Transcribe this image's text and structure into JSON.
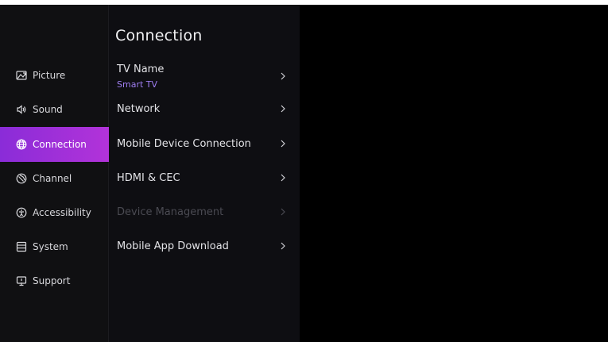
{
  "sidebar": {
    "items": [
      {
        "id": "picture",
        "label": "Picture",
        "icon": "picture-icon",
        "active": false
      },
      {
        "id": "sound",
        "label": "Sound",
        "icon": "speaker-icon",
        "active": false
      },
      {
        "id": "connection",
        "label": "Connection",
        "icon": "globe-icon",
        "active": true
      },
      {
        "id": "channel",
        "label": "Channel",
        "icon": "satellite-dish-icon",
        "active": false
      },
      {
        "id": "accessibility",
        "label": "Accessibility",
        "icon": "accessibility-icon",
        "active": false
      },
      {
        "id": "system",
        "label": "System",
        "icon": "system-icon",
        "active": false
      },
      {
        "id": "support",
        "label": "Support",
        "icon": "support-monitor-icon",
        "active": false
      }
    ]
  },
  "panel": {
    "title": "Connection",
    "items": [
      {
        "label": "TV Name",
        "value": "Smart TV",
        "enabled": true
      },
      {
        "label": "Network",
        "enabled": true
      },
      {
        "label": "Mobile Device Connection",
        "enabled": true
      },
      {
        "label": "HDMI & CEC",
        "enabled": true
      },
      {
        "label": "Device Management",
        "enabled": false
      },
      {
        "label": "Mobile App Download",
        "enabled": true
      }
    ]
  },
  "colors": {
    "accent_gradient_start": "#8a2cd8",
    "accent_gradient_end": "#b233d9",
    "subtitle_value": "#9e7df0",
    "disabled_text": "#4a4a52",
    "background": "#000000"
  }
}
